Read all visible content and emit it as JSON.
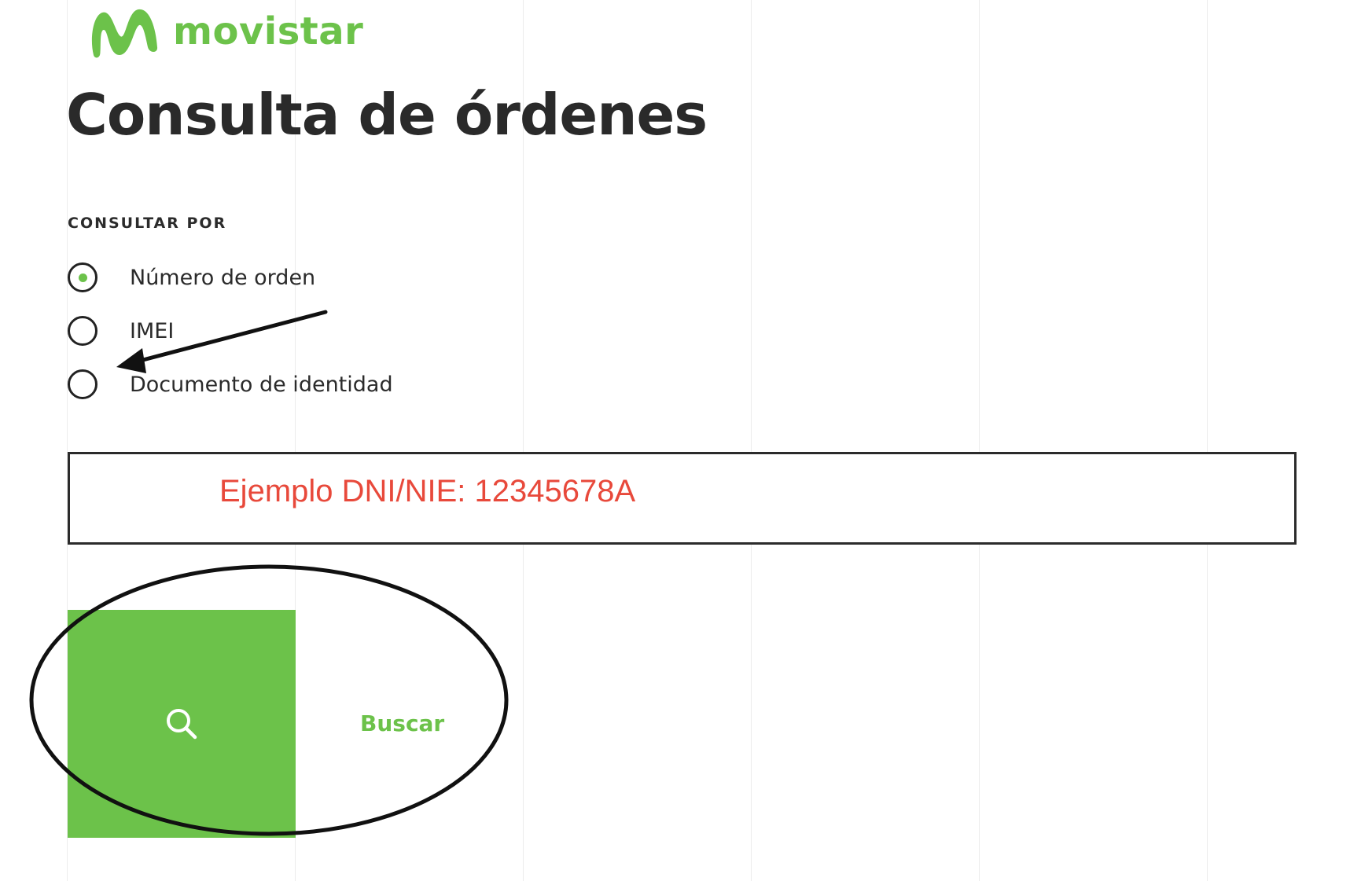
{
  "brand": {
    "name": "movistar",
    "color": "#6cc24a",
    "logo_icon": "movistar-m-icon"
  },
  "page": {
    "title": "Consulta de órdenes"
  },
  "form": {
    "section_label": "CONSULTAR POR",
    "options": [
      {
        "label": "Número de orden",
        "checked": true
      },
      {
        "label": "IMEI",
        "checked": false
      },
      {
        "label": "Documento de identidad",
        "checked": false
      }
    ],
    "input": {
      "placeholder": "Ejemplo DNI/NIE: 12345678A",
      "value": "",
      "placeholder_color": "#e8493b"
    },
    "search_button": {
      "icon": "search-icon",
      "label": "Buscar"
    }
  },
  "annotations": {
    "arrow": "arrow-pointing-to-documento-de-identidad",
    "ellipse": "ellipse-around-search-button"
  }
}
